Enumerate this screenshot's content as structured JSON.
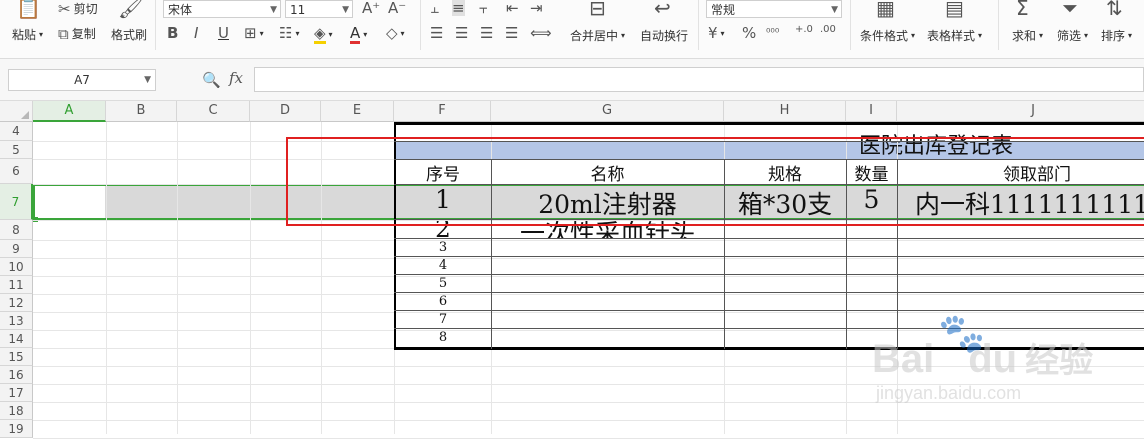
{
  "ribbon": {
    "paste": "粘贴",
    "cut": "剪切",
    "copy": "复制",
    "format_painter": "格式刷",
    "font_name": "宋体",
    "font_size": "11",
    "number_format": "常规",
    "merge_center": "合并居中",
    "wrap_text": "自动换行",
    "conditional_format": "条件格式",
    "table_style": "表格样式",
    "sum": "求和",
    "filter": "筛选",
    "sort": "排序",
    "font_color": "#e03131",
    "fill_color": "#f5d000"
  },
  "formula_bar": {
    "name_box": "A7",
    "fx": "fx",
    "formula": ""
  },
  "columns": [
    "A",
    "B",
    "C",
    "D",
    "E",
    "F",
    "G",
    "H",
    "I",
    "J"
  ],
  "rows": [
    "4",
    "5",
    "6",
    "7",
    "8",
    "9",
    "10",
    "11",
    "12",
    "13",
    "14",
    "15",
    "16",
    "17",
    "18",
    "19"
  ],
  "selected_cell": "A7",
  "sheet": {
    "title": "医院出库登记表",
    "headers": [
      "序号",
      "名称",
      "规格",
      "数量",
      "领取部门"
    ],
    "row1": {
      "no": "1",
      "name": "20ml注射器",
      "spec": "箱*30支",
      "qty": "5",
      "dept": "内一科1111111111"
    },
    "row2": {
      "no": "2",
      "name": "一次性采血针头"
    },
    "numbers": [
      "3",
      "4",
      "5",
      "6",
      "7",
      "8"
    ],
    "title_fill": "#b4c6e7"
  },
  "watermark": {
    "brand": "Bai",
    "brand2": "du",
    "cn": "经验",
    "url": "jingyan.baidu.com"
  }
}
